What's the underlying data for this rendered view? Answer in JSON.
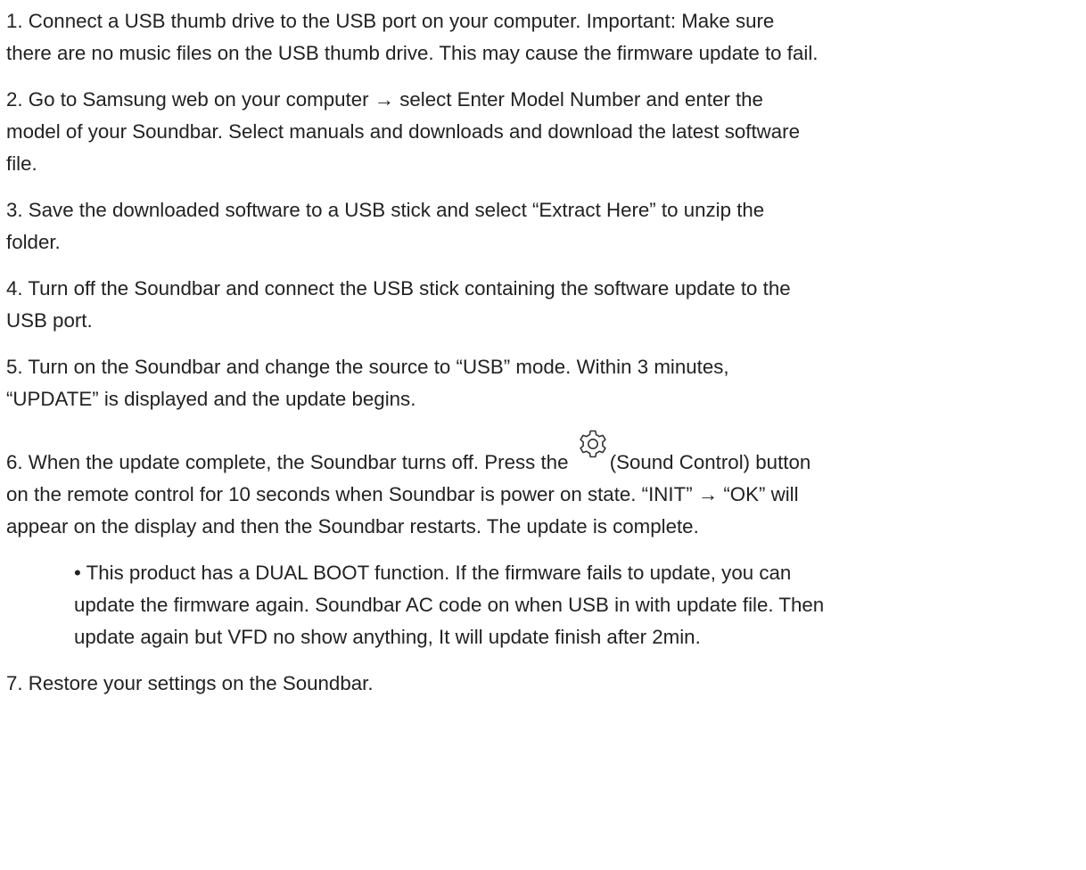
{
  "steps": {
    "s1": "1. Connect a USB thumb drive to the USB port on your computer. Important: Make sure\nthere are no music files on the USB thumb drive. This may cause the firmware update to fail.",
    "s2": "2. Go to Samsung web on your computer → select Enter Model Number and enter the\nmodel of your Soundbar. Select manuals and downloads and download the latest software\nfile.",
    "s3": "3. Save the downloaded software to a USB stick and select “Extract Here” to unzip the\nfolder.",
    "s4": "4. Turn off the Soundbar and connect the USB stick containing the software update to the\nUSB port.",
    "s5": "5. Turn on the Soundbar and change the source to “USB” mode. Within 3 minutes,\n“UPDATE” is displayed and the update begins.",
    "s6_before_icon": "6. When the update complete, the Soundbar turns off. Press the ",
    "s6_after_icon": "(Sound Control) button\non the remote control for 10 seconds when Soundbar is power on state. “INIT” → “OK” will\nappear on the display and then the Soundbar restarts. The update is complete.",
    "s6_icon": "gear-icon",
    "note": "• This product has a DUAL BOOT function. If the firmware fails to update, you can\nupdate the firmware again. Soundbar AC code on when USB in with update file. Then\nupdate again but VFD no show anything, It will update finish after 2min.",
    "s7": "7. Restore your settings on the Soundbar."
  },
  "colors": {
    "text": "#222222",
    "background": "#ffffff"
  }
}
